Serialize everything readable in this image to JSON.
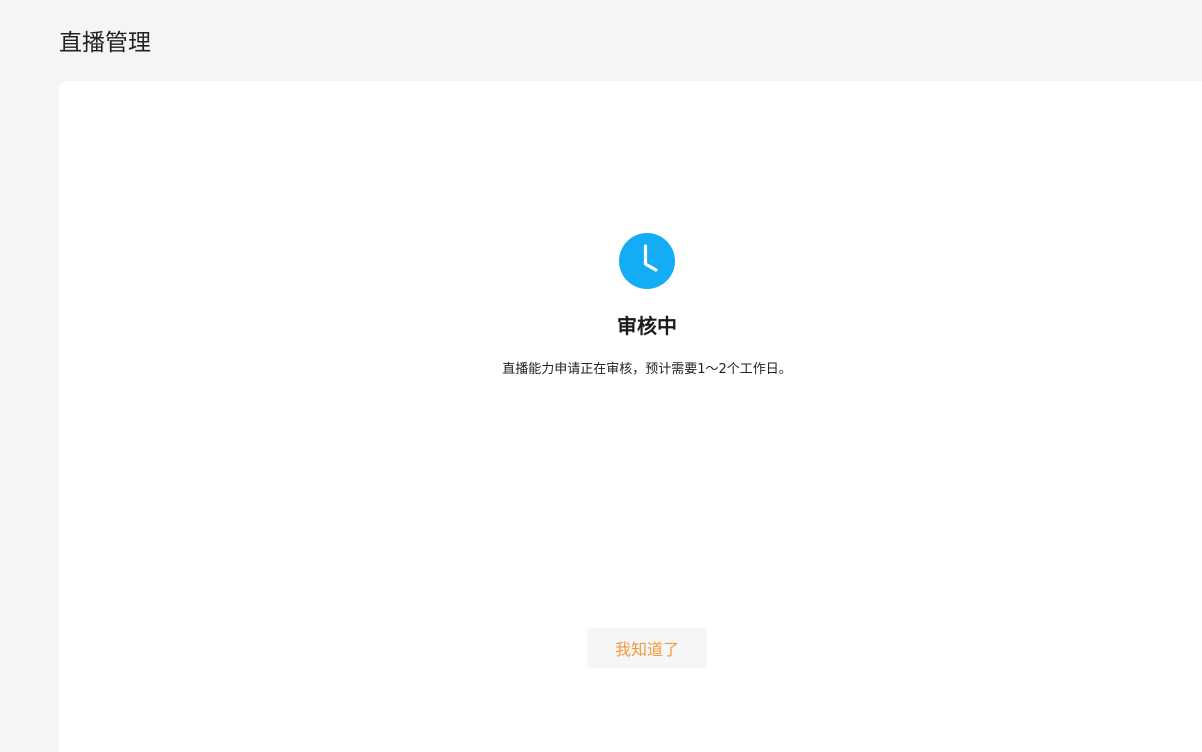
{
  "header": {
    "title": "直播管理"
  },
  "status": {
    "icon": "clock-icon",
    "icon_color": "#14adf5",
    "title": "审核中",
    "description": "直播能力申请正在审核，预计需要1～2个工作日。"
  },
  "actions": {
    "acknowledge_label": "我知道了",
    "acknowledge_color": "#f39a3c"
  }
}
